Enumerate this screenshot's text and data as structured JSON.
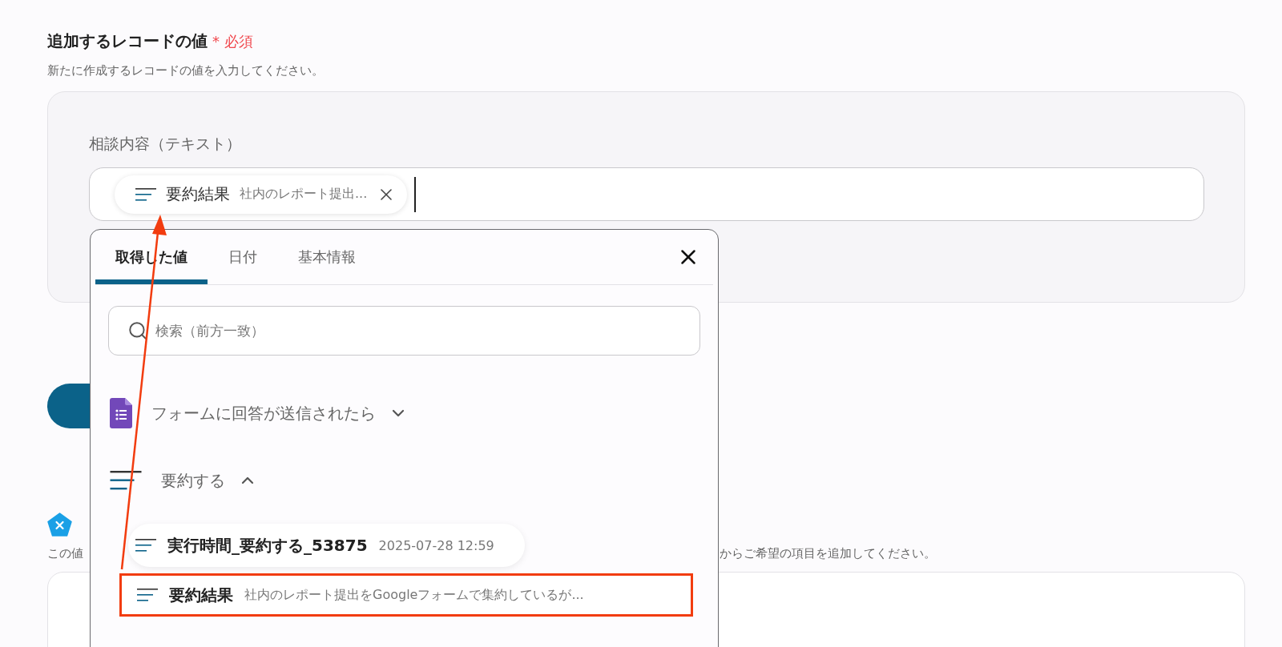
{
  "section": {
    "title": "追加するレコードの値",
    "required_mark": "*",
    "required_label": "必須",
    "description": "新たに作成するレコードの値を入力してください。"
  },
  "field": {
    "label": "相談内容（テキスト）",
    "chip": {
      "name": "要約結果",
      "value": "社内のレポート提出..."
    }
  },
  "next_section": {
    "description_start": "この値",
    "description_end": "からご希望の項目を追加してください。"
  },
  "popup": {
    "tabs": [
      {
        "label": "取得した値",
        "selected": true
      },
      {
        "label": "日付",
        "selected": false
      },
      {
        "label": "基本情報",
        "selected": false
      }
    ],
    "search": {
      "placeholder": "検索（前方一致）"
    },
    "groups": [
      {
        "kind": "form",
        "title": "フォームに回答が送信されたら",
        "expanded": false
      },
      {
        "kind": "summary",
        "title": "要約する",
        "expanded": true,
        "items": [
          {
            "name": "実行時間_要約する_53875",
            "value": "2025-07-28 12:59",
            "highlighted": false
          },
          {
            "name": "要約結果",
            "value": "社内のレポート提出をGoogleフォームで集約しているが...",
            "highlighted": true
          }
        ]
      }
    ]
  }
}
